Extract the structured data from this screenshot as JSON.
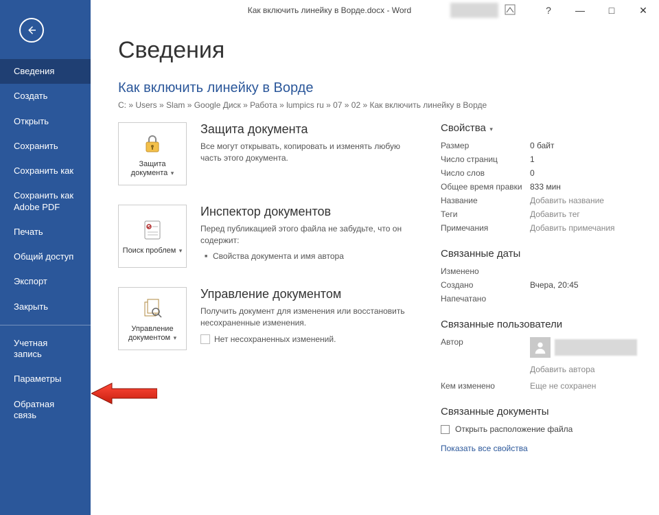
{
  "window": {
    "title": "Как включить линейку в Ворде.docx - Word",
    "help": "?",
    "minimize": "—",
    "maximize": "□",
    "close": "✕"
  },
  "sidebar": {
    "items": [
      {
        "label": "Сведения",
        "active": true
      },
      {
        "label": "Создать"
      },
      {
        "label": "Открыть"
      },
      {
        "label": "Сохранить"
      },
      {
        "label": "Сохранить как"
      },
      {
        "label": "Сохранить как\nAdobe PDF"
      },
      {
        "label": "Печать"
      },
      {
        "label": "Общий доступ"
      },
      {
        "label": "Экспорт"
      },
      {
        "label": "Закрыть"
      }
    ],
    "footer": [
      {
        "label": "Учетная\nзапись"
      },
      {
        "label": "Параметры"
      },
      {
        "label": "Обратная\nсвязь"
      }
    ]
  },
  "page": {
    "title": "Сведения",
    "doc_title": "Как включить линейку в Ворде",
    "breadcrumb": "C: » Users » Slam » Google Диск » Работа » lumpics ru » 07 » 02 » Как включить линейку в Ворде"
  },
  "cards": {
    "protect": {
      "button": "Защита\nдокумента",
      "heading": "Защита документа",
      "body": "Все могут открывать, копировать и изменять любую часть этого документа."
    },
    "inspect": {
      "button": "Поиск\nпроблем",
      "heading": "Инспектор документов",
      "body": "Перед публикацией этого файла не забудьте, что он содержит:",
      "bullet": "Свойства документа и имя автора"
    },
    "manage": {
      "button": "Управление\nдокументом",
      "heading": "Управление документом",
      "body": "Получить документ для изменения или восстановить несохраненные изменения.",
      "none": "Нет несохраненных изменений."
    }
  },
  "props": {
    "heading": "Свойства",
    "rows": [
      {
        "label": "Размер",
        "value": "0 байт"
      },
      {
        "label": "Число страниц",
        "value": "1"
      },
      {
        "label": "Число слов",
        "value": "0"
      },
      {
        "label": "Общее время правки",
        "value": "833 мин"
      },
      {
        "label": "Название",
        "value": "Добавить название",
        "muted": true
      },
      {
        "label": "Теги",
        "value": "Добавить тег",
        "muted": true
      },
      {
        "label": "Примечания",
        "value": "Добавить примечания",
        "muted": true
      }
    ],
    "dates_heading": "Связанные даты",
    "dates": [
      {
        "label": "Изменено",
        "value": ""
      },
      {
        "label": "Создано",
        "value": "Вчера, 20:45"
      },
      {
        "label": "Напечатано",
        "value": ""
      }
    ],
    "people_heading": "Связанные пользователи",
    "author_label": "Автор",
    "add_author": "Добавить автора",
    "changed_by_label": "Кем изменено",
    "changed_by_value": "Еще не сохранен",
    "docs_heading": "Связанные документы",
    "open_location": "Открыть расположение файла",
    "show_all": "Показать все свойства"
  }
}
